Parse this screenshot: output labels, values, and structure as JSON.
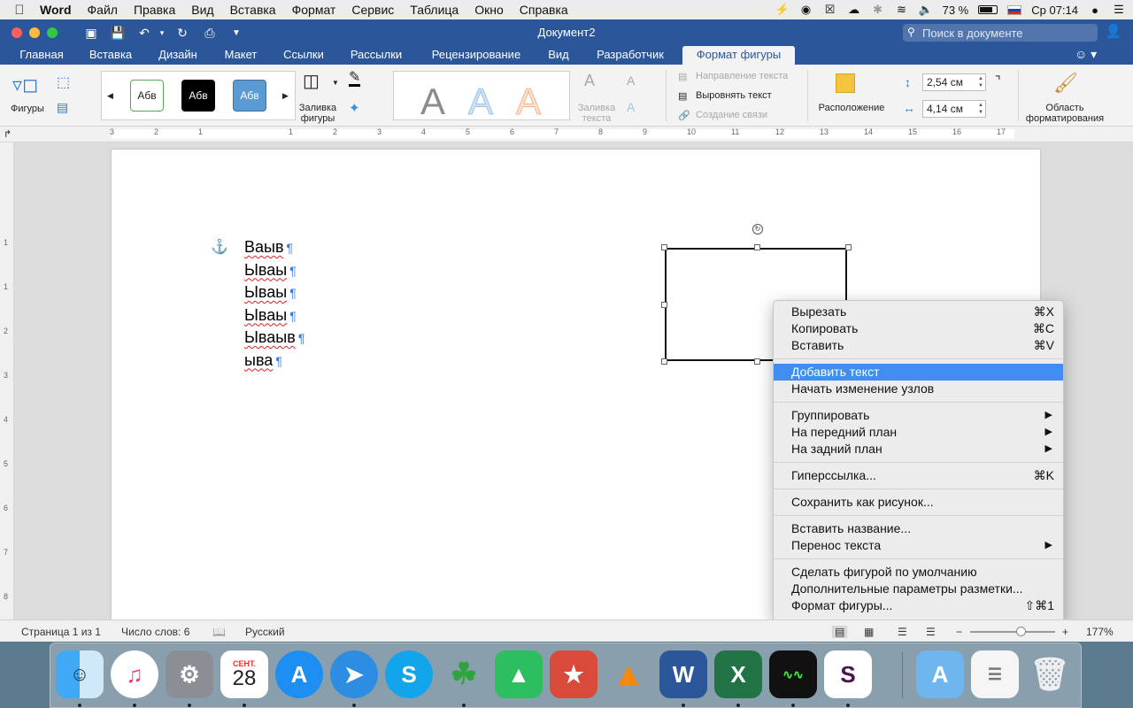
{
  "menubar": {
    "app": "Word",
    "items": [
      "Файл",
      "Правка",
      "Вид",
      "Вставка",
      "Формат",
      "Сервис",
      "Таблица",
      "Окно",
      "Справка"
    ],
    "battery": "73 %",
    "clock": "Ср 07:14"
  },
  "window": {
    "title": "Документ2",
    "search_placeholder": "Поиск в документе"
  },
  "tabs": [
    "Главная",
    "Вставка",
    "Дизайн",
    "Макет",
    "Ссылки",
    "Рассылки",
    "Рецензирование",
    "Вид",
    "Разработчик",
    "Формат фигуры"
  ],
  "ribbon": {
    "shapes_label": "Фигуры",
    "style_swatches": [
      "Абв",
      "Абв",
      "Абв"
    ],
    "fill_label": "Заливка фигуры",
    "text_fill_label": "Заливка текста",
    "text_direction": "Направление текста",
    "align_text": "Выровнять текст",
    "create_link": "Создание связи",
    "arrange": "Расположение",
    "height": "2,54 см",
    "width": "4,14 см",
    "format_pane": "Область форматирования"
  },
  "ruler": {
    "h_numbers": [
      "3",
      "2",
      "1",
      "1",
      "2",
      "3",
      "4",
      "5",
      "6",
      "7",
      "8",
      "9",
      "10",
      "11",
      "12",
      "13",
      "14",
      "15",
      "16",
      "17"
    ],
    "v_numbers": [
      "1",
      "1",
      "2",
      "3",
      "4",
      "5",
      "6",
      "7",
      "8"
    ]
  },
  "document": {
    "lines": [
      "Ваыв",
      "Ываы",
      "Ываы",
      "Ываы",
      "Ываыв",
      "ыва"
    ],
    "pilcrow": "¶",
    "anchor": "⚓"
  },
  "context_menu": {
    "groups": [
      [
        {
          "label": "Вырезать",
          "shortcut": "⌘X"
        },
        {
          "label": "Копировать",
          "shortcut": "⌘C"
        },
        {
          "label": "Вставить",
          "shortcut": "⌘V"
        }
      ],
      [
        {
          "label": "Добавить текст",
          "highlighted": true
        },
        {
          "label": "Начать изменение узлов"
        }
      ],
      [
        {
          "label": "Группировать",
          "submenu": true
        },
        {
          "label": "На передний план",
          "submenu": true
        },
        {
          "label": "На задний план",
          "submenu": true
        }
      ],
      [
        {
          "label": "Гиперссылка...",
          "shortcut": "⌘K"
        }
      ],
      [
        {
          "label": "Сохранить как рисунок..."
        }
      ],
      [
        {
          "label": "Вставить название..."
        },
        {
          "label": "Перенос текста",
          "submenu": true
        }
      ],
      [
        {
          "label": "Сделать фигурой по умолчанию"
        },
        {
          "label": "Дополнительные параметры разметки..."
        },
        {
          "label": "Формат фигуры...",
          "shortcut": "⇧⌘1"
        }
      ]
    ]
  },
  "status": {
    "page": "Страница 1 из 1",
    "words": "Число слов: 6",
    "language": "Русский",
    "zoom": "177%"
  },
  "dock": {
    "calendar_month": "СЕНТ.",
    "calendar_day": "28"
  },
  "colors": {
    "word_blue": "#2b579a",
    "menu_highlight": "#3f8ef0",
    "spell_red": "#e02020",
    "pilcrow_blue": "#3f79d6"
  }
}
